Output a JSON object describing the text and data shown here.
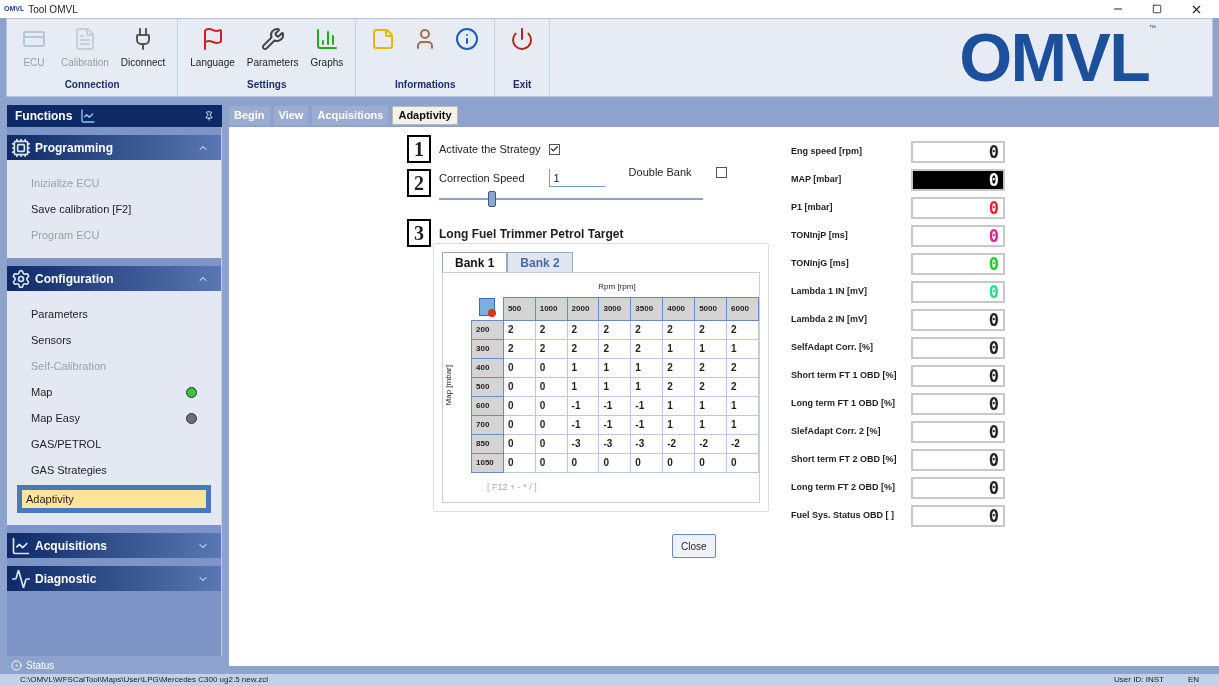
{
  "window": {
    "title": "Tool OMVL",
    "app_mark": "OMVL"
  },
  "ribbon": {
    "groups": [
      {
        "label": "Connection",
        "buttons": [
          {
            "label": "ECU",
            "disabled": true
          },
          {
            "label": "Calibration",
            "disabled": true
          },
          {
            "label": "Diconnect",
            "disabled": false
          }
        ]
      },
      {
        "label": "Settings",
        "buttons": [
          {
            "label": "Language",
            "disabled": false
          },
          {
            "label": "Parameters",
            "disabled": false
          },
          {
            "label": "Graphs",
            "disabled": false
          }
        ]
      },
      {
        "label": "Informations",
        "buttons": [
          {
            "disabled": false
          },
          {
            "disabled": false
          },
          {
            "disabled": false
          }
        ]
      },
      {
        "label": "Exit",
        "buttons": [
          {
            "disabled": false
          }
        ]
      }
    ],
    "logo": "OMVL",
    "logo_mark": "™"
  },
  "sidebar": {
    "title": "Functions",
    "sections": [
      {
        "title": "Programming",
        "expanded": true,
        "items": [
          {
            "label": "Inizialize ECU",
            "disabled": true,
            "selected": false
          },
          {
            "label": "Save calibration [F2]",
            "disabled": false,
            "selected": false
          },
          {
            "label": "Program ECU",
            "disabled": true,
            "selected": false
          }
        ]
      },
      {
        "title": "Configuration",
        "expanded": true,
        "items": [
          {
            "label": "Parameters",
            "disabled": false,
            "selected": false
          },
          {
            "label": "Sensors",
            "disabled": false,
            "selected": false
          },
          {
            "label": "Self-Calibration",
            "disabled": true,
            "selected": false
          },
          {
            "label": "Map",
            "disabled": false,
            "selected": false,
            "color": "#3cc43c"
          },
          {
            "label": "Map Easy",
            "disabled": false,
            "selected": false,
            "color": "#707070"
          },
          {
            "label": "GAS/PETROL",
            "disabled": false,
            "selected": false
          },
          {
            "label": "GAS Strategies",
            "disabled": false,
            "selected": false
          },
          {
            "label": "Adaptivity",
            "disabled": false,
            "selected": true
          }
        ]
      },
      {
        "title": "Acquisitions",
        "expanded": false
      },
      {
        "title": "Diagnostic",
        "expanded": false
      }
    ]
  },
  "tabs": [
    {
      "label": "Begin",
      "selected": false
    },
    {
      "label": "View",
      "selected": false
    },
    {
      "label": "Acquisitions",
      "selected": false
    },
    {
      "label": "Adaptivity",
      "selected": true
    }
  ],
  "strategy": {
    "step": "1",
    "label": "Activate the Strategy",
    "checked": true
  },
  "correction": {
    "step": "2",
    "label": "Correction Speed",
    "value": "1",
    "level": 0.2,
    "double_bank": {
      "label": "Double Bank",
      "checked": false
    }
  },
  "trimmer": {
    "step": "3",
    "title": "Long Fuel Trimmer Petrol Target",
    "banks": [
      {
        "label": "Bank 1",
        "selected": true
      },
      {
        "label": "Bank 2",
        "selected": false
      }
    ],
    "x_axis": "Rpm [rpm]",
    "y_axis": "Map [mbar]",
    "columns": [
      "500",
      "1000",
      "2000",
      "3000",
      "3500",
      "4000",
      "5000",
      "6000"
    ],
    "rows": [
      {
        "map": "200",
        "values": [
          "2",
          "2",
          "2",
          "2",
          "2",
          "2",
          "2",
          "2"
        ]
      },
      {
        "map": "300",
        "values": [
          "2",
          "2",
          "2",
          "2",
          "2",
          "1",
          "1",
          "1"
        ]
      },
      {
        "map": "400",
        "values": [
          "0",
          "0",
          "1",
          "1",
          "1",
          "2",
          "2",
          "2"
        ]
      },
      {
        "map": "500",
        "values": [
          "0",
          "0",
          "1",
          "1",
          "1",
          "2",
          "2",
          "2"
        ]
      },
      {
        "map": "600",
        "values": [
          "0",
          "0",
          "-1",
          "-1",
          "-1",
          "1",
          "1",
          "1"
        ]
      },
      {
        "map": "700",
        "values": [
          "0",
          "0",
          "-1",
          "-1",
          "-1",
          "1",
          "1",
          "1"
        ]
      },
      {
        "map": "850",
        "values": [
          "0",
          "0",
          "-3",
          "-3",
          "-3",
          "-2",
          "-2",
          "-2"
        ]
      },
      {
        "map": "1050",
        "values": [
          "0",
          "0",
          "0",
          "0",
          "0",
          "0",
          "0",
          "0"
        ]
      }
    ],
    "hint": "[ F12 + - * / ]"
  },
  "close_button": "Close",
  "sensors": [
    {
      "label": "Eng speed [rpm]",
      "value": "0",
      "kind": "light",
      "color": "#222222"
    },
    {
      "label": "MAP [mbar]",
      "value": "0",
      "kind": "dark"
    },
    {
      "label": "P1 [mbar]",
      "value": "0",
      "kind": "light",
      "color": "#ee2222"
    },
    {
      "label": "TONInjP [ms]",
      "value": "0",
      "kind": "light",
      "color": "#e02090"
    },
    {
      "label": "TONInjG [ms]",
      "value": "0",
      "kind": "light",
      "color": "#22cc22"
    },
    {
      "label": "Lambda 1 IN [mV]",
      "value": "0",
      "kind": "light",
      "color": "#22dd88"
    },
    {
      "label": "Lambda 2 IN [mV]",
      "value": "0",
      "kind": "light",
      "color": "#222222"
    },
    {
      "label": "SelfAdapt Corr. [%]",
      "value": "0",
      "kind": "light",
      "color": "#222222"
    },
    {
      "label": "Short term FT 1 OBD [%]",
      "value": "0",
      "kind": "light",
      "color": "#222222"
    },
    {
      "label": "Long term FT 1 OBD [%]",
      "value": "0",
      "kind": "light",
      "color": "#222222"
    },
    {
      "label": "SlefAdapt Corr. 2 [%]",
      "value": "0",
      "kind": "light",
      "color": "#222222"
    },
    {
      "label": "Short term FT 2 OBD [%]",
      "value": "0",
      "kind": "light",
      "color": "#222222"
    },
    {
      "label": "Long term FT 2 OBD [%]",
      "value": "0",
      "kind": "light",
      "color": "#222222"
    },
    {
      "label": "Fuel Sys. Status OBD [ ]",
      "value": "0",
      "kind": "light",
      "color": "#222222"
    }
  ],
  "status": {
    "label": "Status",
    "path": "C:\\OMVL\\WFSCalTool\\Maps\\User\\LPG\\Mercedes C300 ug2.5 new.zcl",
    "user": "User ID: INST",
    "lang": "EN"
  }
}
